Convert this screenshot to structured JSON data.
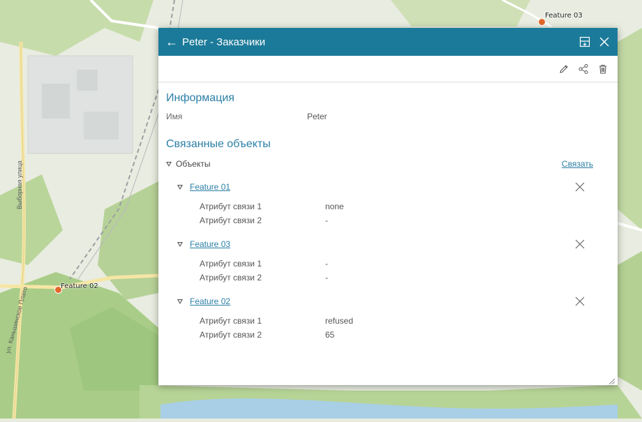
{
  "map": {
    "labels": {
      "feature_03": "Feature 03",
      "feature_02": "Feature 02",
      "street_1": "Выборная улица",
      "street_2": "ул. Каньшинское Плато"
    },
    "marker_color": "#e2672b"
  },
  "panel": {
    "title": "Peter - Заказчики",
    "header_color": "#1b7a99",
    "icons": {
      "back": "arrow-left-icon",
      "dock": "dock-panel-icon",
      "close": "close-icon",
      "edit": "pencil-icon",
      "share": "share-icon",
      "delete": "trash-icon"
    },
    "info": {
      "section_title": "Информация",
      "name_label": "Имя",
      "name_value": "Peter"
    },
    "related": {
      "section_title": "Связанные объекты",
      "objects_label": "Объекты",
      "link_action": "Связать",
      "features": [
        {
          "name": "Feature 01",
          "attr1_label": "Атрибут связи 1",
          "attr1_value": "none",
          "attr2_label": "Атрибут связи 2",
          "attr2_value": "-"
        },
        {
          "name": "Feature 03",
          "attr1_label": "Атрибут связи 1",
          "attr1_value": "-",
          "attr2_label": "Атрибут связи 2",
          "attr2_value": "-"
        },
        {
          "name": "Feature 02",
          "attr1_label": "Атрибут связи 1",
          "attr1_value": "refused",
          "attr2_label": "Атрибут связи 2",
          "attr2_value": "65"
        }
      ]
    }
  }
}
